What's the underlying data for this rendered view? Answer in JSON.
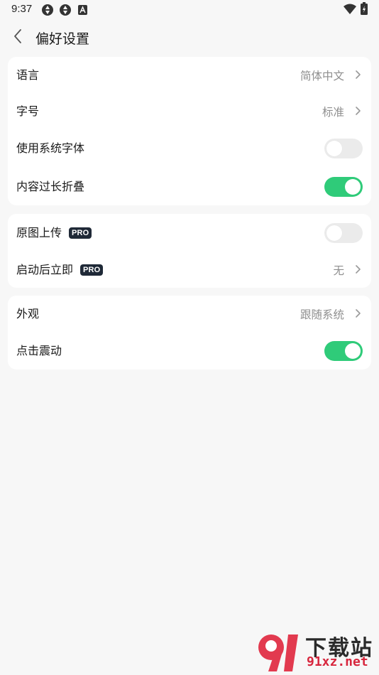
{
  "status_bar": {
    "time": "9:37",
    "icons": [
      "sync-icon",
      "sync-icon",
      "app-notification-icon",
      "wifi-icon",
      "battery-icon"
    ]
  },
  "header": {
    "back_icon": "chevron-left-icon",
    "title": "偏好设置"
  },
  "groups": [
    {
      "rows": [
        {
          "label": "语言",
          "value": "简体中文",
          "control": "chevron"
        },
        {
          "label": "字号",
          "value": "标准",
          "control": "chevron"
        },
        {
          "label": "使用系统字体",
          "control": "toggle",
          "on": false
        },
        {
          "label": "内容过长折叠",
          "control": "toggle",
          "on": true
        }
      ]
    },
    {
      "rows": [
        {
          "label": "原图上传",
          "badge": "PRO",
          "control": "toggle",
          "on": false
        },
        {
          "label": "启动后立即",
          "badge": "PRO",
          "value": "无",
          "control": "chevron"
        }
      ]
    },
    {
      "rows": [
        {
          "label": "外观",
          "value": "跟随系统",
          "control": "chevron"
        },
        {
          "label": "点击震动",
          "control": "toggle",
          "on": true
        }
      ]
    }
  ],
  "colors": {
    "background": "#f7f7f7",
    "card": "#ffffff",
    "toggle_on": "#2fcb79",
    "toggle_off": "#ebebeb",
    "badge": "#1f2937",
    "secondary_text": "#8e8e8e"
  },
  "watermark": {
    "title": "下载站",
    "url": "91xz.net"
  }
}
